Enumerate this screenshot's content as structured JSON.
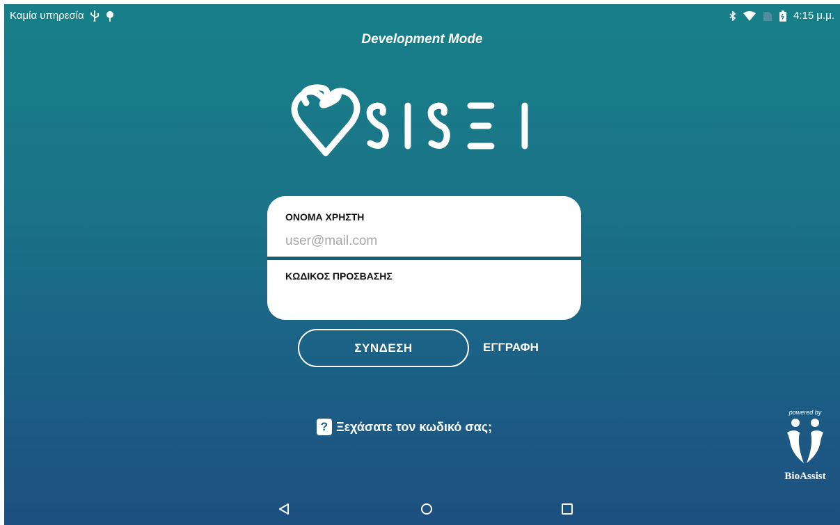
{
  "status_bar": {
    "carrier_text": "Καμία υπηρεσία",
    "time": "4:15 μ.μ.",
    "icons": [
      "usb-icon",
      "android-debug-icon",
      "bluetooth-icon",
      "wifi-icon",
      "no-sim-icon",
      "battery-icon"
    ]
  },
  "header": {
    "mode_label": "Development Mode"
  },
  "logo": {
    "text": "SISEI",
    "icon": "heart-stethoscope-icon"
  },
  "login_form": {
    "username_label": "ΟΝΟΜΑ ΧΡΗΣΤΗ",
    "username_placeholder": "user@mail.com",
    "username_value": "",
    "password_label": "ΚΩΔΙΚΟΣ ΠΡΟΣΒΑΣΗΣ",
    "password_value": ""
  },
  "actions": {
    "login_label": "ΣΥΝΔΕΣΗ",
    "register_label": "ΕΓΓΡΑΦΗ",
    "forgot_label": "Ξεχάσατε τον κωδικό σας;",
    "forgot_icon": "question-icon"
  },
  "branding": {
    "powered_by": "powered by",
    "name": "BioAssist"
  },
  "nav_bar": {
    "buttons": [
      "back-icon",
      "home-icon",
      "recents-icon"
    ]
  },
  "colors": {
    "background_top": "#187f88",
    "background_bottom": "#1d4f80",
    "card": "#ffffff",
    "divider": "#185f74"
  }
}
